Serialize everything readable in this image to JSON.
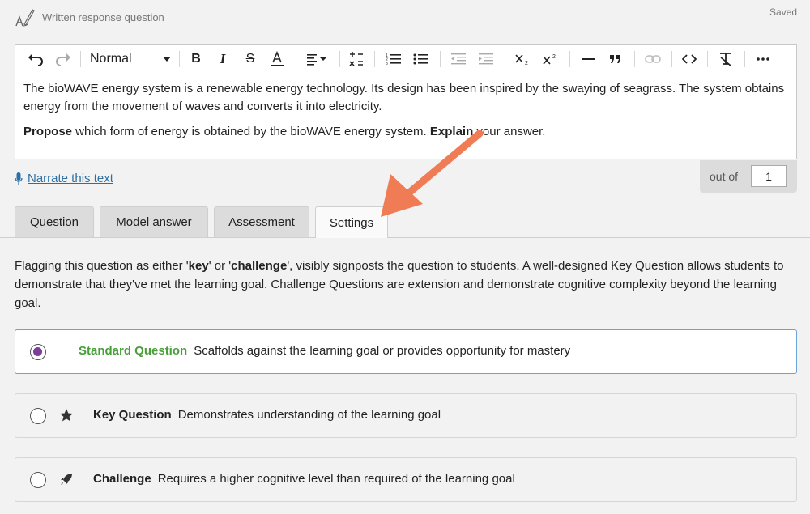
{
  "header": {
    "question_type": "Written response question",
    "status": "Saved"
  },
  "toolbar": {
    "format_value": "Normal",
    "icons": [
      "undo-icon",
      "redo-icon",
      "bold-icon",
      "italic-icon",
      "strikethrough-icon",
      "font-color-icon",
      "align-icon",
      "insert-formula-icon",
      "ordered-list-icon",
      "bullet-list-icon",
      "outdent-icon",
      "indent-icon",
      "subscript-icon",
      "superscript-icon",
      "horizontal-rule-icon",
      "blockquote-icon",
      "link-icon",
      "code-icon",
      "clear-format-icon",
      "more-icon"
    ]
  },
  "editor": {
    "paragraph1": "The bioWAVE energy system is a renewable energy technology. Its design has been inspired by the swaying of seagrass. The system obtains energy from the movement of waves and converts it into electricity.",
    "p2_bold1": "Propose",
    "p2_text1": " which form of energy is obtained by the bioWAVE energy system. ",
    "p2_bold2": "Explain",
    "p2_text2": " your answer."
  },
  "narrate": {
    "label": "Narrate this text"
  },
  "marks": {
    "label": "out of",
    "value": "1"
  },
  "tabs": [
    {
      "label": "Question"
    },
    {
      "label": "Model answer"
    },
    {
      "label": "Assessment"
    },
    {
      "label": "Settings",
      "active": true
    }
  ],
  "settings": {
    "d1": "Flagging this question as either '",
    "d_key": "key",
    "d2": "' or '",
    "d_challenge": "challenge",
    "d3": "', visibly signposts the question to students. A well-designed Key Question allows students to demonstrate that they've met the learning goal. Challenge Questions are extension and demonstrate cognitive complexity beyond the learning goal.",
    "options": [
      {
        "title": "Standard Question",
        "detail": "Scaffolds against the learning goal or provides opportunity for mastery",
        "selected": true
      },
      {
        "title": "Key Question",
        "detail": "Demonstrates understanding of the learning goal",
        "icon": "star-icon",
        "selected": false
      },
      {
        "title": "Challenge",
        "detail": "Requires a higher cognitive level than required of the learning goal",
        "icon": "rocket-icon",
        "selected": false
      }
    ]
  },
  "colors": {
    "accent_green": "#4a9e3a",
    "radio_purple": "#7b3f9b",
    "link_blue": "#2d6fa3",
    "arrow_orange": "#f07c55"
  }
}
